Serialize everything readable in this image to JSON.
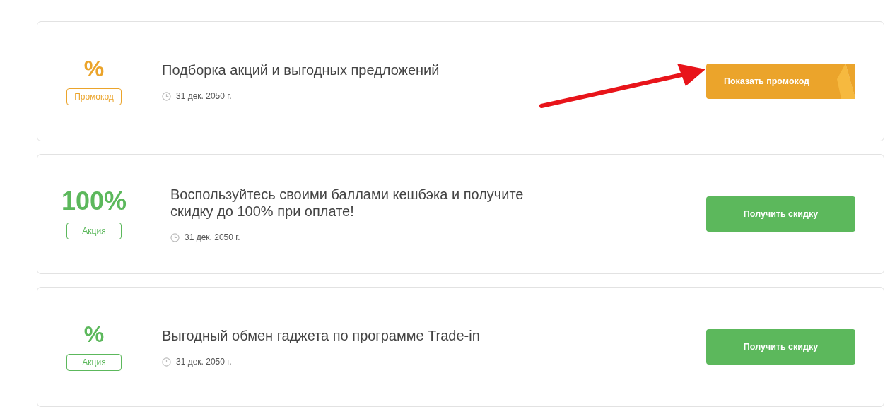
{
  "offers": [
    {
      "kind": "promo",
      "value": "%",
      "tag": "Промокод",
      "title": "Подборка акций и выгодных предложений",
      "date": "31 дек. 2050 г.",
      "button": "Показать промокод",
      "arrow": true
    },
    {
      "kind": "sale",
      "value": "100%",
      "tag": "Акция",
      "title": "Воспользуйтесь своими баллами кешбэка и получите скидку до 100% при оплате!",
      "date": "31 дек. 2050 г.",
      "button": "Получить скидку",
      "arrow": false
    },
    {
      "kind": "sale",
      "value": "%",
      "tag": "Акция",
      "title": "Выгодный обмен гаджета по программе Trade-in",
      "date": "31 дек. 2050 г.",
      "button": "Получить скидку",
      "arrow": false
    }
  ]
}
